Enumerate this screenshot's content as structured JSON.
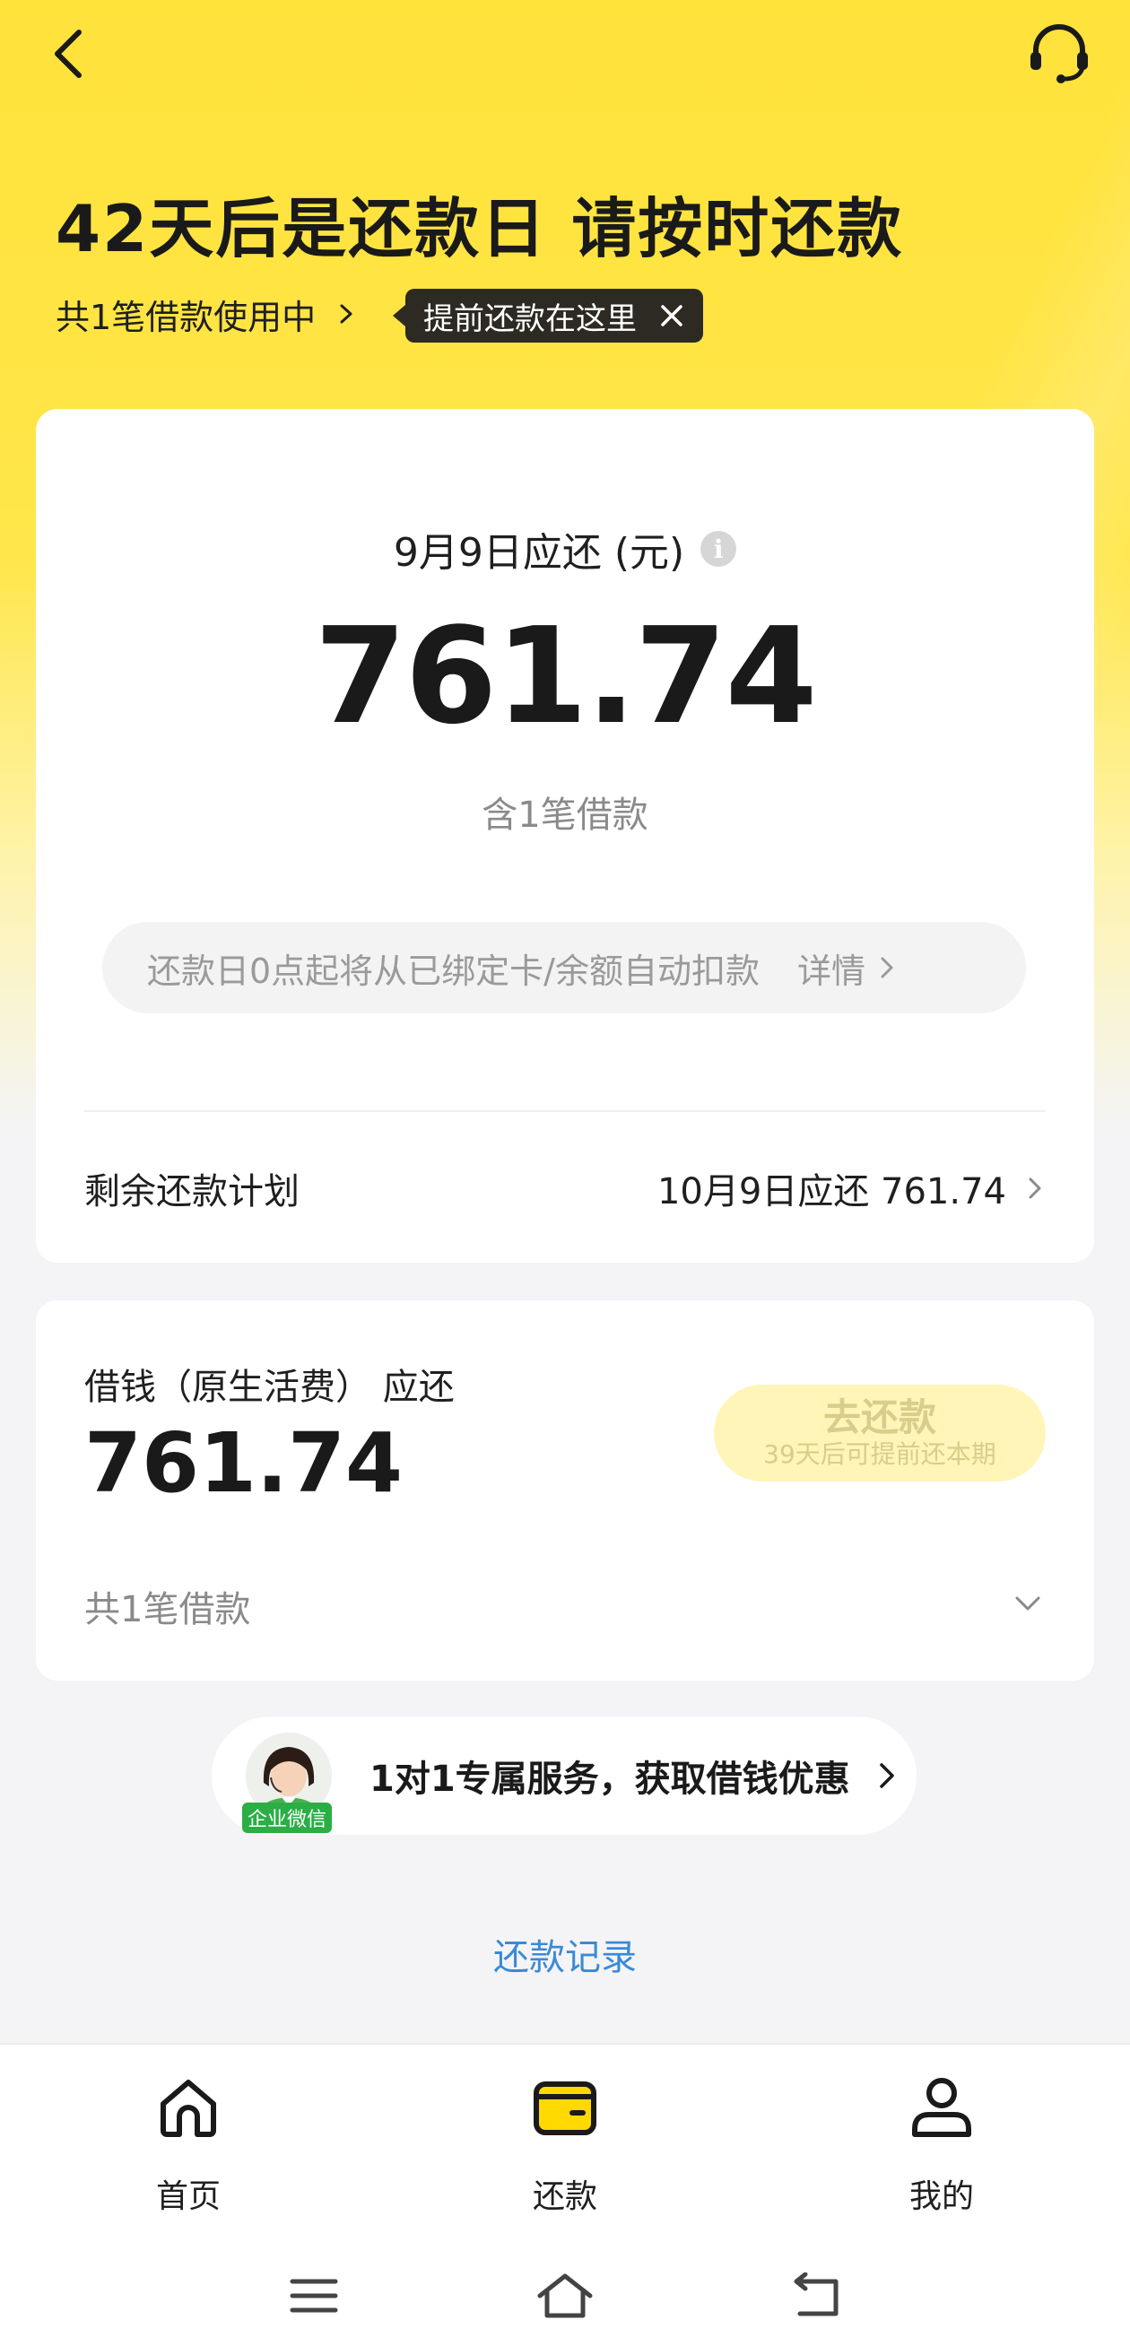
{
  "header": {
    "title": "42天后是还款日 请按时还款",
    "loan_link": "共1笔借款使用中",
    "tooltip": "提前还款在这里"
  },
  "summary": {
    "due_label": "9月9日应还 (元)",
    "info_symbol": "i",
    "due_amount": "761.74",
    "loan_count": "含1笔借款",
    "autopay_notice": "还款日0点起将从已绑定卡/余额自动扣款",
    "detail_link": "详情",
    "plan_label": "剩余还款计划",
    "plan_value": "10月9日应还 761.74"
  },
  "loan": {
    "title": "借钱（原生活费） 应还",
    "amount": "761.74",
    "repay_button": "去还款",
    "repay_hint": "39天后可提前还本期",
    "count": "共1笔借款"
  },
  "service": {
    "badge": "企业微信",
    "text": "1对1专属服务，获取借钱优惠"
  },
  "history_link": "还款记录",
  "tabs": [
    {
      "label": "首页",
      "icon": "home-icon"
    },
    {
      "label": "还款",
      "icon": "wallet-card-icon",
      "active": true
    },
    {
      "label": "我的",
      "icon": "user-icon"
    }
  ],
  "colors": {
    "brand_yellow": "#ffe23a",
    "link_blue": "#3a8ad6",
    "disabled_button": "#fff5b8",
    "wechat_green": "#2aae45"
  }
}
